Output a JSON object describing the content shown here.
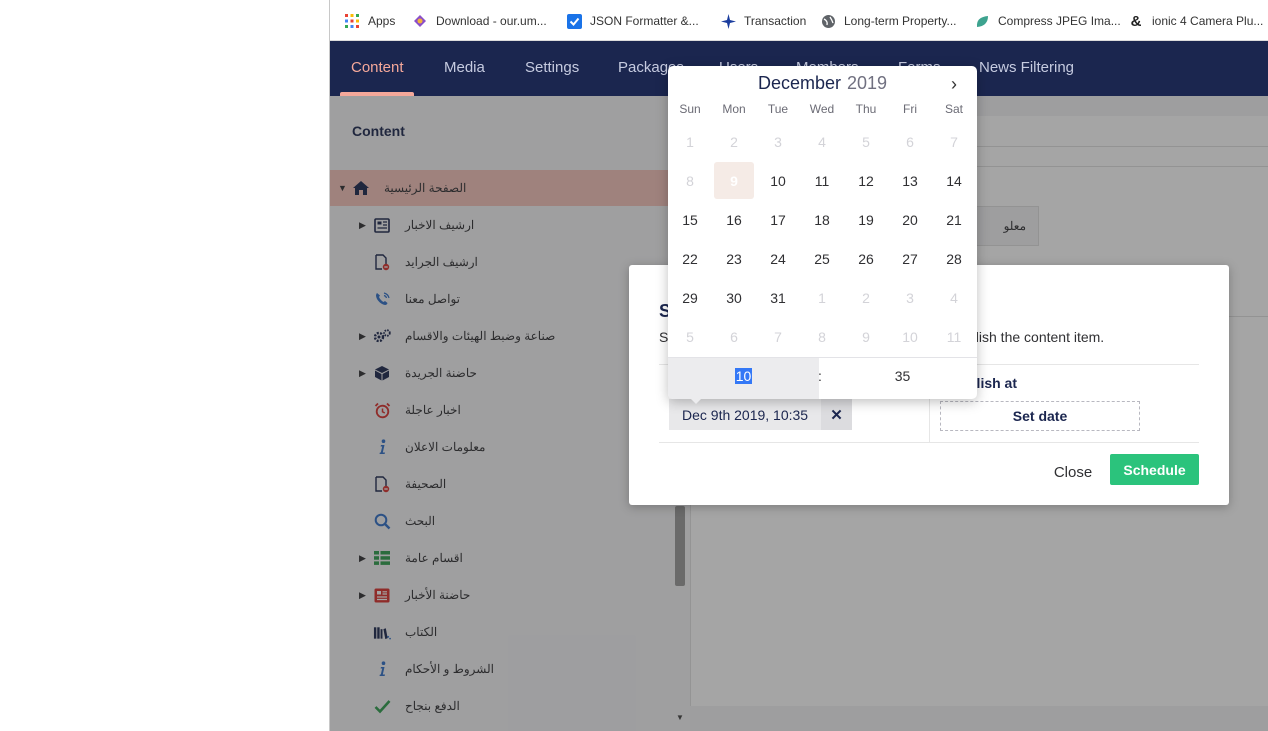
{
  "bookmarks": [
    {
      "label": "Apps",
      "icon": "apps-grid-icon"
    },
    {
      "label": "Download - our.um...",
      "icon": "umbraco-icon"
    },
    {
      "label": "JSON Formatter &...",
      "icon": "checkbox-icon"
    },
    {
      "label": "Transaction",
      "icon": "star-icon"
    },
    {
      "label": "Long-term Property...",
      "icon": "globe-icon"
    },
    {
      "label": "Compress JPEG Ima...",
      "icon": "leaf-icon"
    },
    {
      "label": "ionic 4 Camera Plu...",
      "icon": "ampersand-icon"
    }
  ],
  "nav": {
    "items": [
      "Content",
      "Media",
      "Settings",
      "Packages",
      "Users",
      "Members",
      "Forms",
      "News Filtering"
    ],
    "active": "Content"
  },
  "sidebar": {
    "title": "Content",
    "tree": [
      {
        "label": "الصفحة الرئيسية",
        "icon": "home-icon",
        "color": "#1b264f",
        "caret": "down",
        "active": true
      },
      {
        "label": "ارشيف الاخبار",
        "icon": "newspaper-icon",
        "color": "#1b264f",
        "caret": "right"
      },
      {
        "label": "ارشيف الجرايد",
        "icon": "document-blocked-icon",
        "color": "#1b264f",
        "caret": ""
      },
      {
        "label": "تواصل معنا",
        "icon": "phone-icon",
        "color": "#2f6fc9",
        "caret": ""
      },
      {
        "label": "صناعة وضبط الهيئات والاقسام",
        "icon": "gears-icon",
        "color": "#1b264f",
        "caret": "right"
      },
      {
        "label": "حاضنة الجريدة",
        "icon": "cube-icon",
        "color": "#1b264f",
        "caret": "right"
      },
      {
        "label": "اخبار عاجلة",
        "icon": "alarm-icon",
        "color": "#d9302c",
        "caret": ""
      },
      {
        "label": "معلومات الاعلان",
        "icon": "info-icon",
        "color": "#2f6fc9",
        "caret": ""
      },
      {
        "label": "الصحيفة",
        "icon": "document-blocked-icon",
        "color": "#1b264f",
        "caret": ""
      },
      {
        "label": "البحث",
        "icon": "search-icon",
        "color": "#2f6fc9",
        "caret": ""
      },
      {
        "label": "اقسام عامة",
        "icon": "grid-list-icon",
        "color": "#2e9d4d",
        "caret": "right"
      },
      {
        "label": "حاضنة الأخبار",
        "icon": "news-icon",
        "color": "#d9302c",
        "caret": "right"
      },
      {
        "label": "الكتاب",
        "icon": "books-icon",
        "color": "#1b264f",
        "caret": ""
      },
      {
        "label": "الشروط و الأحكام",
        "icon": "info-icon",
        "color": "#2f6fc9",
        "caret": ""
      },
      {
        "label": "الدفع بنجاح",
        "icon": "checkmark-icon",
        "color": "#2e9d4d",
        "caret": ""
      }
    ]
  },
  "main": {
    "tab_label": "معلو"
  },
  "dialog": {
    "title": "S",
    "desc_left": "S",
    "desc_right": "blish the content item.",
    "publish_label": "blish at",
    "date_value": "Dec 9th 2019, 10:35",
    "clear_label": "✕",
    "set_date_label": "Set date",
    "close_label": "Close",
    "schedule_label": "Schedule",
    "schedule_color": "#2bc37c"
  },
  "calendar": {
    "month": "December",
    "year": "2019",
    "next_icon": "›",
    "weekdays": [
      "Sun",
      "Mon",
      "Tue",
      "Wed",
      "Thu",
      "Fri",
      "Sat"
    ],
    "weeks": [
      [
        {
          "d": "1",
          "m": true
        },
        {
          "d": "2",
          "m": true
        },
        {
          "d": "3",
          "m": true
        },
        {
          "d": "4",
          "m": true
        },
        {
          "d": "5",
          "m": true
        },
        {
          "d": "6",
          "m": true
        },
        {
          "d": "7",
          "m": true
        }
      ],
      [
        {
          "d": "8",
          "m": true
        },
        {
          "d": "9",
          "today": true
        },
        {
          "d": "10"
        },
        {
          "d": "11"
        },
        {
          "d": "12"
        },
        {
          "d": "13"
        },
        {
          "d": "14"
        }
      ],
      [
        {
          "d": "15"
        },
        {
          "d": "16"
        },
        {
          "d": "17"
        },
        {
          "d": "18"
        },
        {
          "d": "19"
        },
        {
          "d": "20"
        },
        {
          "d": "21"
        }
      ],
      [
        {
          "d": "22"
        },
        {
          "d": "23"
        },
        {
          "d": "24"
        },
        {
          "d": "25"
        },
        {
          "d": "26"
        },
        {
          "d": "27"
        },
        {
          "d": "28"
        }
      ],
      [
        {
          "d": "29"
        },
        {
          "d": "30"
        },
        {
          "d": "31"
        },
        {
          "d": "1",
          "m": true
        },
        {
          "d": "2",
          "m": true
        },
        {
          "d": "3",
          "m": true
        },
        {
          "d": "4",
          "m": true
        }
      ],
      [
        {
          "d": "5",
          "m": true
        },
        {
          "d": "6",
          "m": true
        },
        {
          "d": "7",
          "m": true
        },
        {
          "d": "8",
          "m": true
        },
        {
          "d": "9",
          "m": true
        },
        {
          "d": "10",
          "m": true
        },
        {
          "d": "11",
          "m": true
        }
      ]
    ],
    "hour": "10",
    "colon": ":",
    "minute": "35"
  }
}
